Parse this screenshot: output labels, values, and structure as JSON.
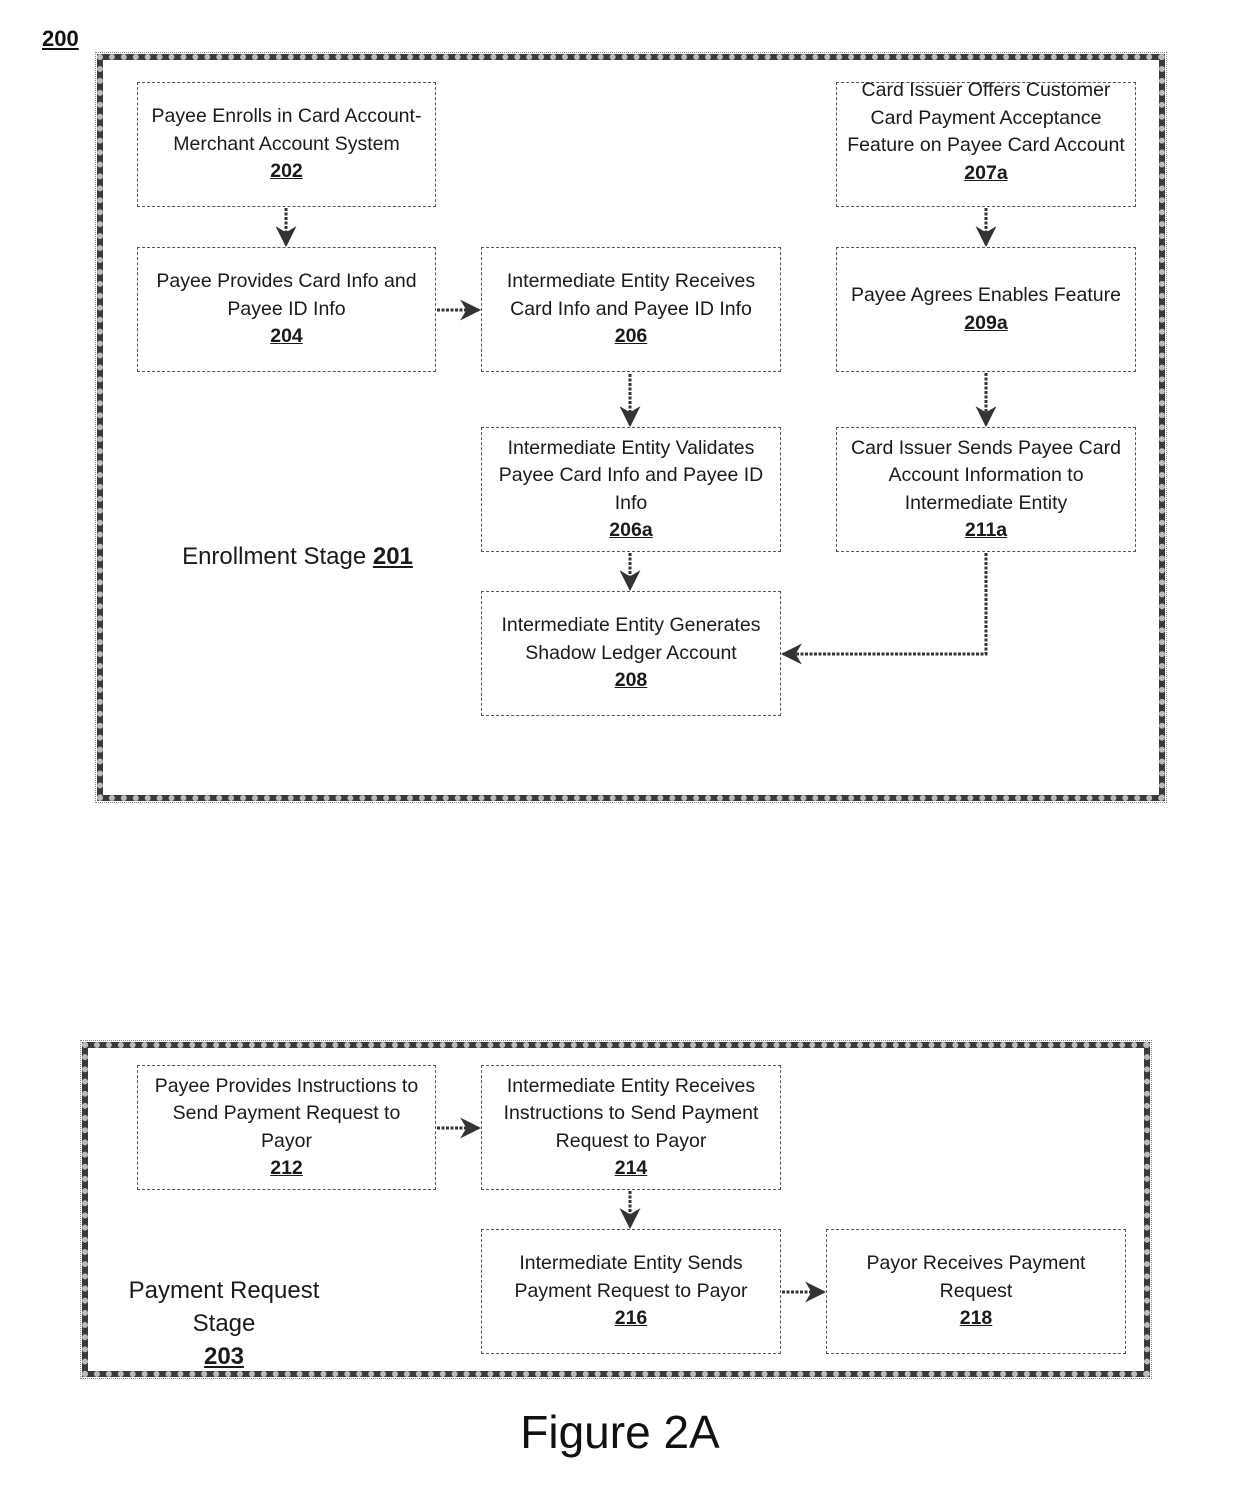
{
  "figure": {
    "number": "200",
    "caption": "Figure 2A"
  },
  "stages": {
    "enrollment": {
      "label": "Enrollment Stage ",
      "ref": "201"
    },
    "payment_request": {
      "label_line1": "Payment Request",
      "label_line2": "Stage",
      "ref": "203"
    }
  },
  "boxes": {
    "b202": {
      "text": "Payee Enrolls in Card Account-Merchant Account System",
      "ref": "202"
    },
    "b204": {
      "text": "Payee Provides Card Info and Payee ID Info",
      "ref": "204"
    },
    "b206": {
      "text": "Intermediate Entity Receives Card Info and Payee ID Info",
      "ref": "206"
    },
    "b206a": {
      "text": "Intermediate Entity Validates Payee Card Info and Payee ID Info",
      "ref": "206a"
    },
    "b208": {
      "text": "Intermediate Entity Generates Shadow Ledger Account",
      "ref": "208"
    },
    "b207a": {
      "text": "Card Issuer Offers Customer Card Payment Acceptance Feature on Payee Card Account",
      "ref": "207a"
    },
    "b209a": {
      "text": "Payee Agrees Enables Feature",
      "ref": "209a"
    },
    "b211a": {
      "text": "Card Issuer Sends Payee Card Account Information to Intermediate Entity",
      "ref": "211a"
    },
    "b212": {
      "text": "Payee Provides Instructions to Send Payment Request to Payor",
      "ref": "212"
    },
    "b214": {
      "text": "Intermediate Entity Receives Instructions to Send Payment Request to Payor",
      "ref": "214"
    },
    "b216": {
      "text": "Intermediate Entity Sends Payment Request to Payor",
      "ref": "216"
    },
    "b218": {
      "text": "Payor Receives Payment Request",
      "ref": "218"
    }
  },
  "flows": [
    {
      "from": "202",
      "to": "204"
    },
    {
      "from": "204",
      "to": "206"
    },
    {
      "from": "206",
      "to": "206a"
    },
    {
      "from": "206a",
      "to": "208"
    },
    {
      "from": "207a",
      "to": "209a"
    },
    {
      "from": "209a",
      "to": "211a"
    },
    {
      "from": "211a",
      "to": "208"
    },
    {
      "from": "212",
      "to": "214"
    },
    {
      "from": "214",
      "to": "216"
    },
    {
      "from": "216",
      "to": "218"
    }
  ]
}
